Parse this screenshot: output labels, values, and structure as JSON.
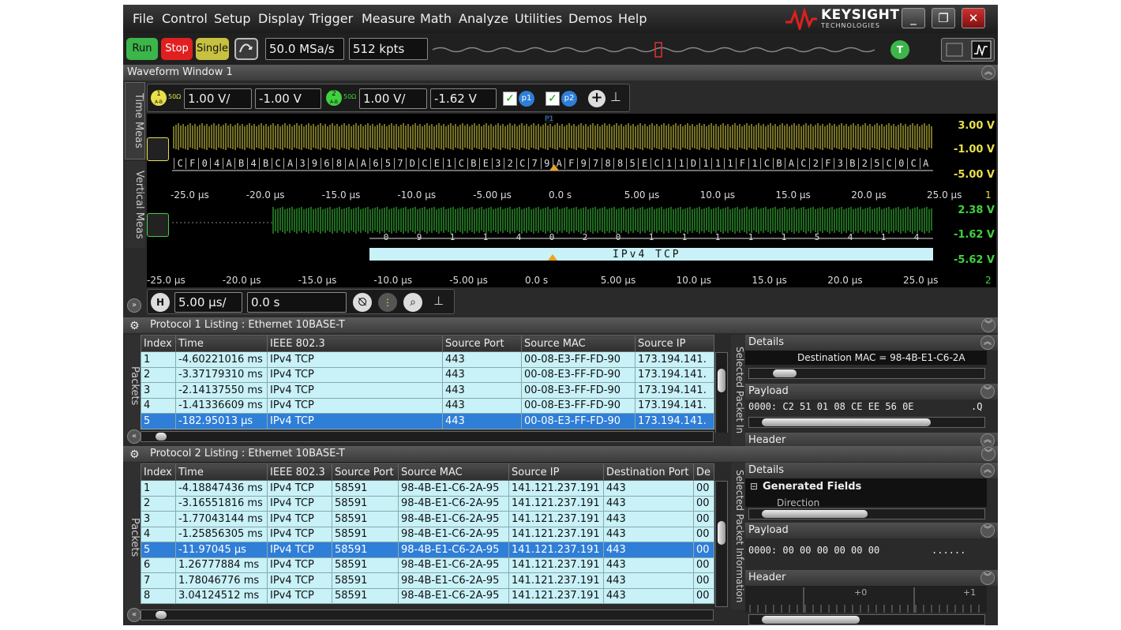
{
  "menu": [
    "File",
    "Control",
    "Setup",
    "Display",
    "Trigger",
    "Measure",
    "Math",
    "Analyze",
    "Utilities",
    "Demos",
    "Help"
  ],
  "brand": {
    "name": "KEYSIGHT",
    "sub": "TECHNOLOGIES"
  },
  "window_buttons": {
    "minimize": "_",
    "restore": "❐",
    "close": "✕"
  },
  "toolbar": {
    "run": "Run",
    "stop": "Stop",
    "single": "Single",
    "sample_rate": "50.0 MSa/s",
    "memory_depth": "512 kpts",
    "trigger_badge": "T"
  },
  "waveform_window": {
    "title": "Waveform Window 1"
  },
  "side_tabs": {
    "time_meas": "Time Meas",
    "vertical_meas": "Vertical Meas"
  },
  "channels": {
    "ch1": {
      "label": "1",
      "sub": "A-B",
      "impedance": "50Ω",
      "scale": "1.00 V/",
      "offset": "-1.00 V"
    },
    "ch2": {
      "label": "2",
      "sub": "A-B",
      "impedance": "50Ω",
      "scale": "1.00 V/",
      "offset": "-1.62 V"
    },
    "p1": "p1",
    "p2": "p2",
    "p1_marker": "P1"
  },
  "grid1": {
    "v_labels": [
      "3.00 V",
      "-1.00 V",
      "-5.00 V"
    ],
    "index": "1",
    "ticks": [
      "-25.0 µs",
      "-20.0 µs",
      "-15.0 µs",
      "-10.0 µs",
      "-5.00 µs",
      "0.0 s",
      "5.00 µs",
      "10.0 µs",
      "15.0 µs",
      "20.0 µs",
      "25.0 µs"
    ],
    "hex": [
      "C",
      "F",
      "0",
      "4",
      "A",
      "B",
      "4",
      "B",
      "C",
      "A",
      "3",
      "9",
      "6",
      "8",
      "A",
      "A",
      "6",
      "5",
      "7",
      "D",
      "C",
      "E",
      "1",
      "C",
      "B",
      "E",
      "3",
      "2",
      "C",
      "7",
      "9",
      "A",
      "F",
      "9",
      "7",
      "8",
      "8",
      "5",
      "E",
      "C",
      "1",
      "1",
      "D",
      "1",
      "1",
      "1",
      "F",
      "1",
      "C",
      "B",
      "A",
      "C",
      "2",
      "F",
      "3",
      "B",
      "2",
      "5",
      "C",
      "0",
      "C",
      "A"
    ]
  },
  "grid2": {
    "v_labels": [
      "2.38 V",
      "-1.62 V",
      "-5.62 V"
    ],
    "index": "2",
    "ticks": [
      "-25.0 µs",
      "-20.0 µs",
      "-15.0 µs",
      "-10.0 µs",
      "-5.00 µs",
      "0.0 s",
      "5.00 µs",
      "10.0 µs",
      "15.0 µs",
      "20.0 µs",
      "25.0 µs"
    ],
    "bits": [
      "0",
      "9",
      "1",
      "1",
      "4",
      "0",
      "2",
      "0",
      "1",
      "1",
      "1",
      "1",
      "1",
      "5",
      "4",
      "1",
      "4"
    ],
    "decode_label": "IPv4 TCP"
  },
  "timebase": {
    "h": "H",
    "scale": "5.00 µs/",
    "position": "0.0 s"
  },
  "protocol1": {
    "title": "Protocol 1 Listing : Ethernet 10BASE-T",
    "side_tab": "Packets",
    "columns": [
      "Index",
      "Time",
      "IEEE 802.3",
      "Source Port",
      "Source MAC",
      "Source IP"
    ],
    "rows": [
      [
        "1",
        "-4.60221016 ms",
        "IPv4 TCP",
        "443",
        "00-08-E3-FF-FD-90",
        "173.194.141."
      ],
      [
        "2",
        "-3.37179310 ms",
        "IPv4 TCP",
        "443",
        "00-08-E3-FF-FD-90",
        "173.194.141."
      ],
      [
        "3",
        "-2.14137550 ms",
        "IPv4 TCP",
        "443",
        "00-08-E3-FF-FD-90",
        "173.194.141."
      ],
      [
        "4",
        "-1.41336609 ms",
        "IPv4 TCP",
        "443",
        "00-08-E3-FF-FD-90",
        "173.194.141."
      ],
      [
        "5",
        "-182.95013 µs",
        "IPv4 TCP",
        "443",
        "00-08-E3-FF-FD-90",
        "173.194.141."
      ]
    ],
    "selected_row": 4,
    "info_tab": "Selected Packet In",
    "details_title": "Details",
    "details_line": "Destination MAC = 98-4B-E1-C6-2A",
    "payload_title": "Payload",
    "payload_line": "0000:  C2 51 01 08 CE EE 56 0E",
    "payload_ascii": ".Q",
    "header_title": "Header"
  },
  "protocol2": {
    "title": "Protocol 2 Listing : Ethernet 10BASE-T",
    "side_tab": "Packets",
    "columns": [
      "Index",
      "Time",
      "IEEE 802.3",
      "Source Port",
      "Source MAC",
      "Source IP",
      "Destination Port",
      "De"
    ],
    "rows": [
      [
        "1",
        "-4.18847436 ms",
        "IPv4 TCP",
        "58591",
        "98-4B-E1-C6-2A-95",
        "141.121.237.191",
        "443",
        "00"
      ],
      [
        "2",
        "-3.16551816 ms",
        "IPv4 TCP",
        "58591",
        "98-4B-E1-C6-2A-95",
        "141.121.237.191",
        "443",
        "00"
      ],
      [
        "3",
        "-1.77043144 ms",
        "IPv4 TCP",
        "58591",
        "98-4B-E1-C6-2A-95",
        "141.121.237.191",
        "443",
        "00"
      ],
      [
        "4",
        "-1.25856305 ms",
        "IPv4 TCP",
        "58591",
        "98-4B-E1-C6-2A-95",
        "141.121.237.191",
        "443",
        "00"
      ],
      [
        "5",
        "-11.97045 µs",
        "IPv4 TCP",
        "58591",
        "98-4B-E1-C6-2A-95",
        "141.121.237.191",
        "443",
        "00"
      ],
      [
        "6",
        "1.26777884 ms",
        "IPv4 TCP",
        "58591",
        "98-4B-E1-C6-2A-95",
        "141.121.237.191",
        "443",
        "00"
      ],
      [
        "7",
        "1.78046776 ms",
        "IPv4 TCP",
        "58591",
        "98-4B-E1-C6-2A-95",
        "141.121.237.191",
        "443",
        "00"
      ],
      [
        "8",
        "3.04124512 ms",
        "IPv4 TCP",
        "58591",
        "98-4B-E1-C6-2A-95",
        "141.121.237.191",
        "443",
        "00"
      ]
    ],
    "selected_row": 4,
    "info_tab": "Selected Packet Information",
    "details_title": "Details",
    "details_group": "Generated Fields",
    "details_sub": "Direction",
    "payload_title": "Payload",
    "payload_line": "0000:  00 00 00 00 00 00",
    "payload_ascii": "......",
    "header_title": "Header",
    "header_ticks": [
      "+0",
      "+1"
    ]
  },
  "colors": {
    "ch1": "#e8e04a",
    "ch2": "#3fd23f",
    "table_row": "#c8f1f8",
    "selected": "#2f7ed8",
    "run": "#3cb54a",
    "stop": "#e02020",
    "single": "#c8c040"
  }
}
